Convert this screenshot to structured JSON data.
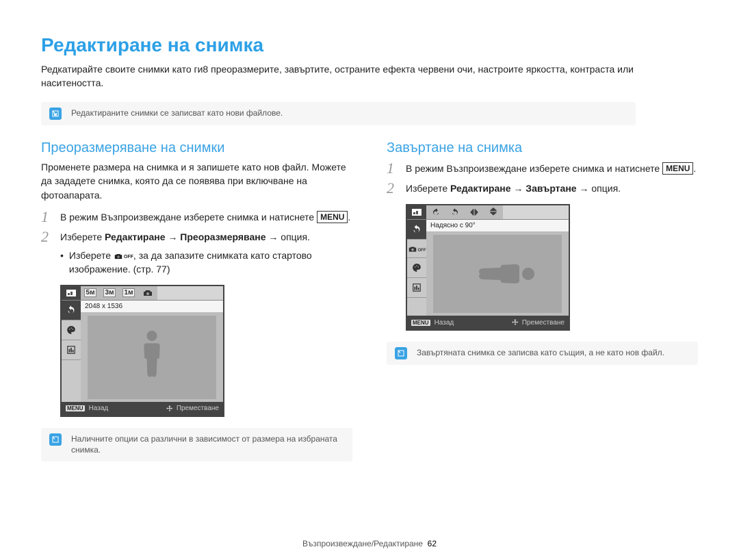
{
  "title": "Редактиране на снимка",
  "intro": "Редкатирайте своите снимки като ги8 преоразмерите, завъртите, остраните ефекта червени очи, настроите яркостта, контраста или наситеността.",
  "top_note": "Редактираните снимки се записват като нови файлове.",
  "left": {
    "heading": "Преоразмеряване на снимки",
    "intro": "Променете размера на снимка и я запишете като нов файл. Можете да зададете снимка, която да се появява при включване на фотоапарата.",
    "step1_a": "В режим Възпроизвеждане изберете снимка и натиснете ",
    "step1_menu": "MENU",
    "step1_b": ".",
    "step2_a": "Изберете ",
    "step2_b": "Редактиране",
    "step2_c": " → ",
    "step2_d": "Преоразмеряване",
    "step2_e": " → опция.",
    "bullet_a": "Изберете ",
    "bullet_off": "OFF",
    "bullet_b": ", за да запазите снимката като стартово изображение. (стр. 77)",
    "note": "Наличните опции са различни в зависимост от размера на избраната снимка.",
    "screen": {
      "size_labels": [
        "5м",
        "3м",
        "1м"
      ],
      "status": "2048 x 1536",
      "back_btn": "MENU",
      "back_label": "Назад",
      "move_label": "Преместване"
    }
  },
  "right": {
    "heading": "Завъртане на снимка",
    "step1_a": "В режим Възпроизвеждане изберете снимка и натиснете ",
    "step1_menu": "MENU",
    "step1_b": ".",
    "step2_a": "Изберете ",
    "step2_b": "Редактиране",
    "step2_c": " → ",
    "step2_d": "Завъртане",
    "step2_e": " → опция.",
    "note": "Завъртяната снимка се записва като същия, а не като нов файл.",
    "screen": {
      "status": "Надясно с 90°",
      "back_btn": "MENU",
      "back_label": "Назад",
      "move_label": "Преместване"
    }
  },
  "footer": {
    "text": "Възпроизвеждане/Редактиране",
    "page": "62"
  }
}
